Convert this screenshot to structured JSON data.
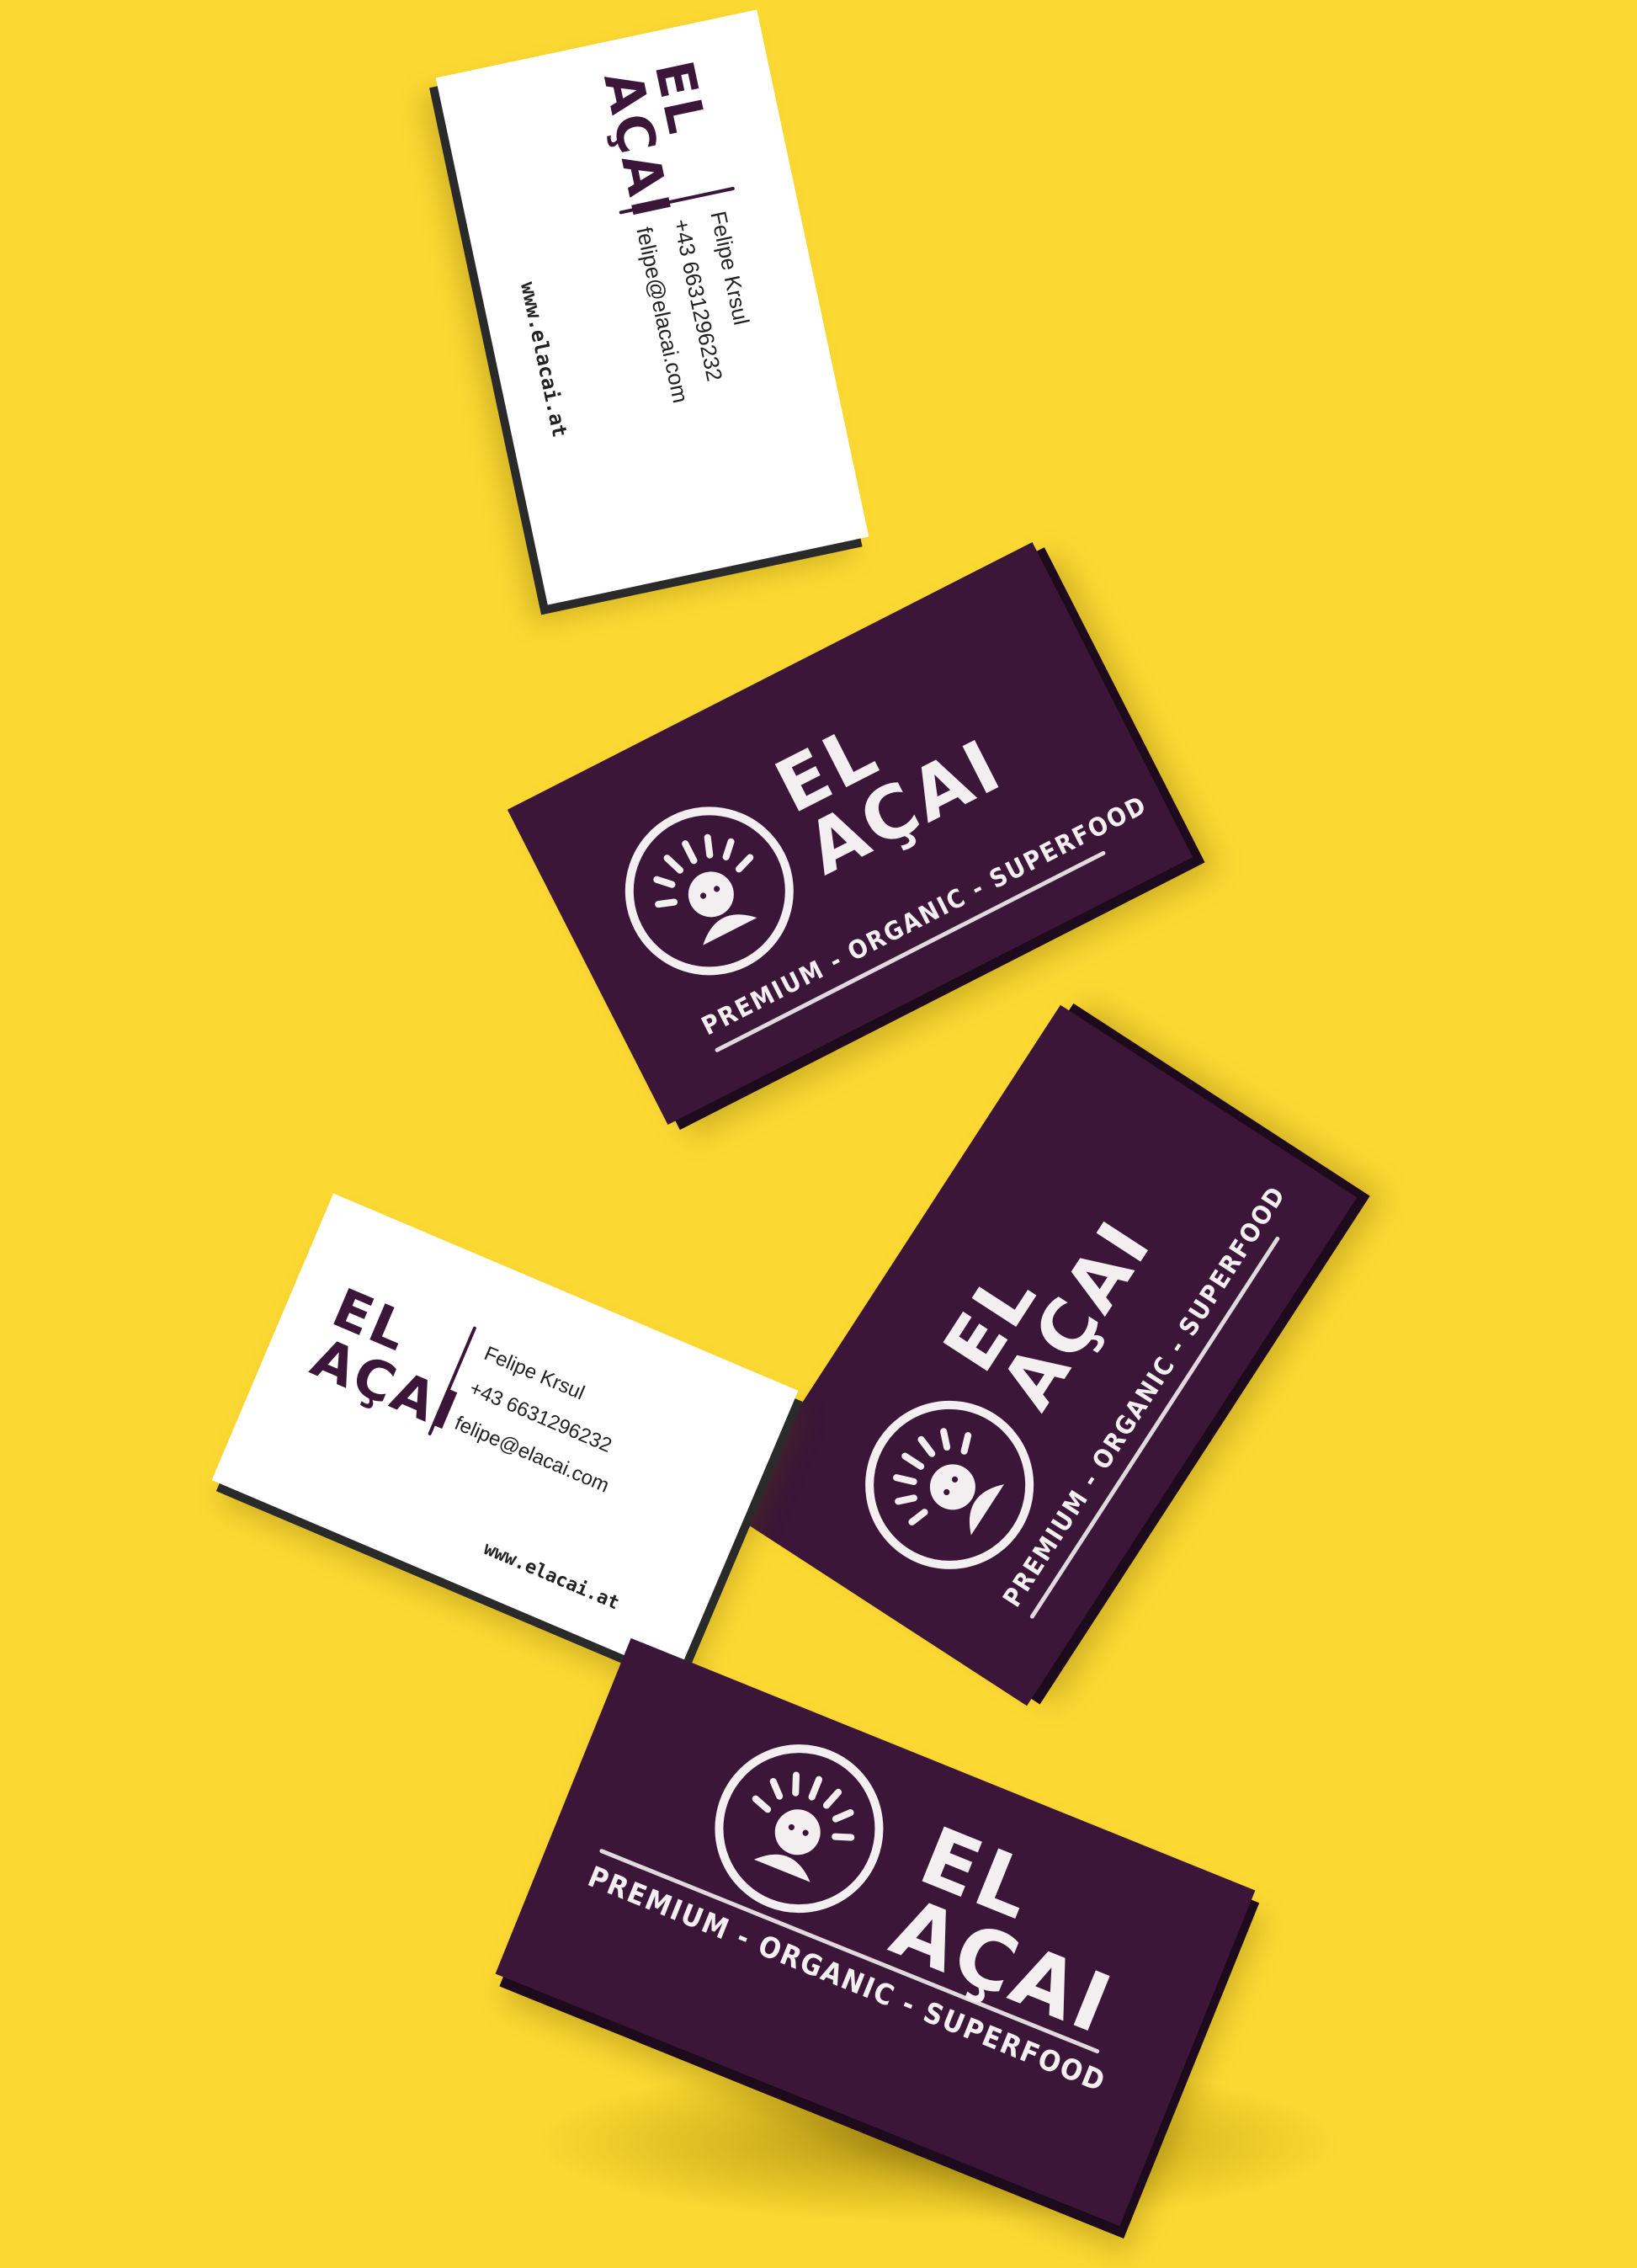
{
  "brand": {
    "line1": "EL",
    "line2": "AÇAI",
    "tagline": "PREMIUM - ORGANIC - SUPERFOOD"
  },
  "contact": {
    "name": "Felipe Krsul",
    "phone": "+43 6631296232",
    "email": "felipe@elacai.com",
    "website": "www.elacai.at"
  },
  "colors": {
    "background": "#fcd932",
    "card_purple": "#3b1638",
    "card_white": "#ffffff",
    "ink": "#f3eef0"
  },
  "icons": {
    "emblem": "acai-girl-emblem-icon"
  }
}
